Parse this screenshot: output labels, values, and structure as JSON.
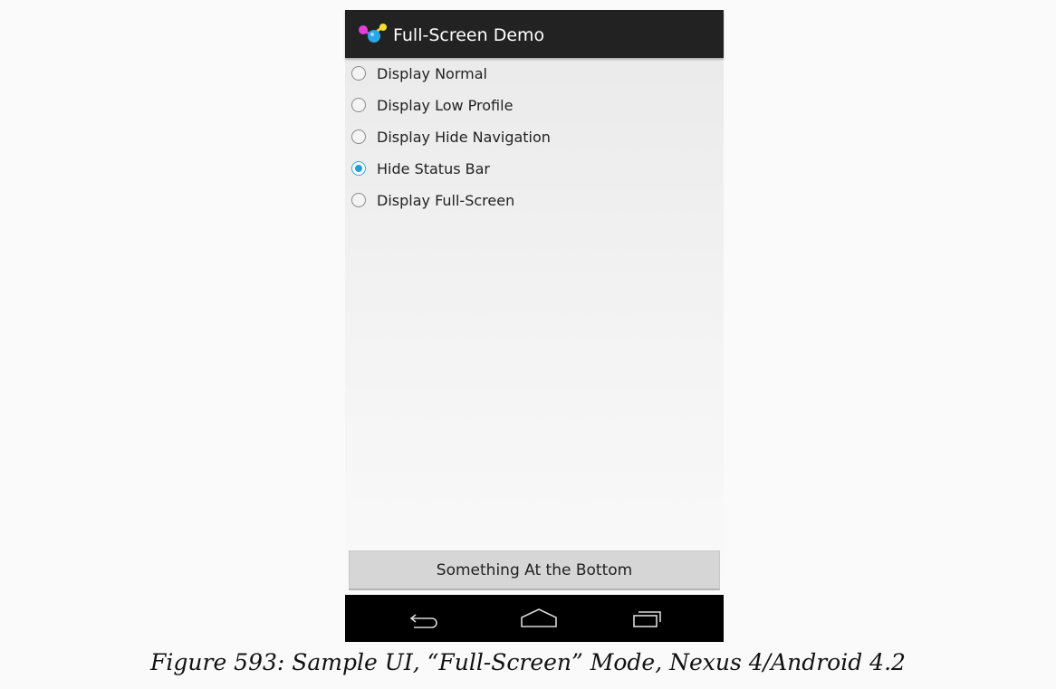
{
  "app": {
    "title": "Full-Screen Demo",
    "icon": "app-logo-icon"
  },
  "radio_options": [
    {
      "label": "Display Normal",
      "checked": false
    },
    {
      "label": "Display Low Profile",
      "checked": false
    },
    {
      "label": "Display Hide Navigation",
      "checked": false
    },
    {
      "label": "Hide Status Bar",
      "checked": true
    },
    {
      "label": "Display Full-Screen",
      "checked": false
    }
  ],
  "bottom_button": {
    "label": "Something At the Bottom"
  },
  "nav_bar": {
    "back_icon": "back-icon",
    "home_icon": "home-icon",
    "recents_icon": "recents-icon"
  },
  "colors": {
    "action_bar": "#222222",
    "accent": "#21a0d8",
    "nav_bar": "#000000"
  },
  "caption": "Figure 593: Sample UI, “Full-Screen” Mode, Nexus 4/Android 4.2"
}
